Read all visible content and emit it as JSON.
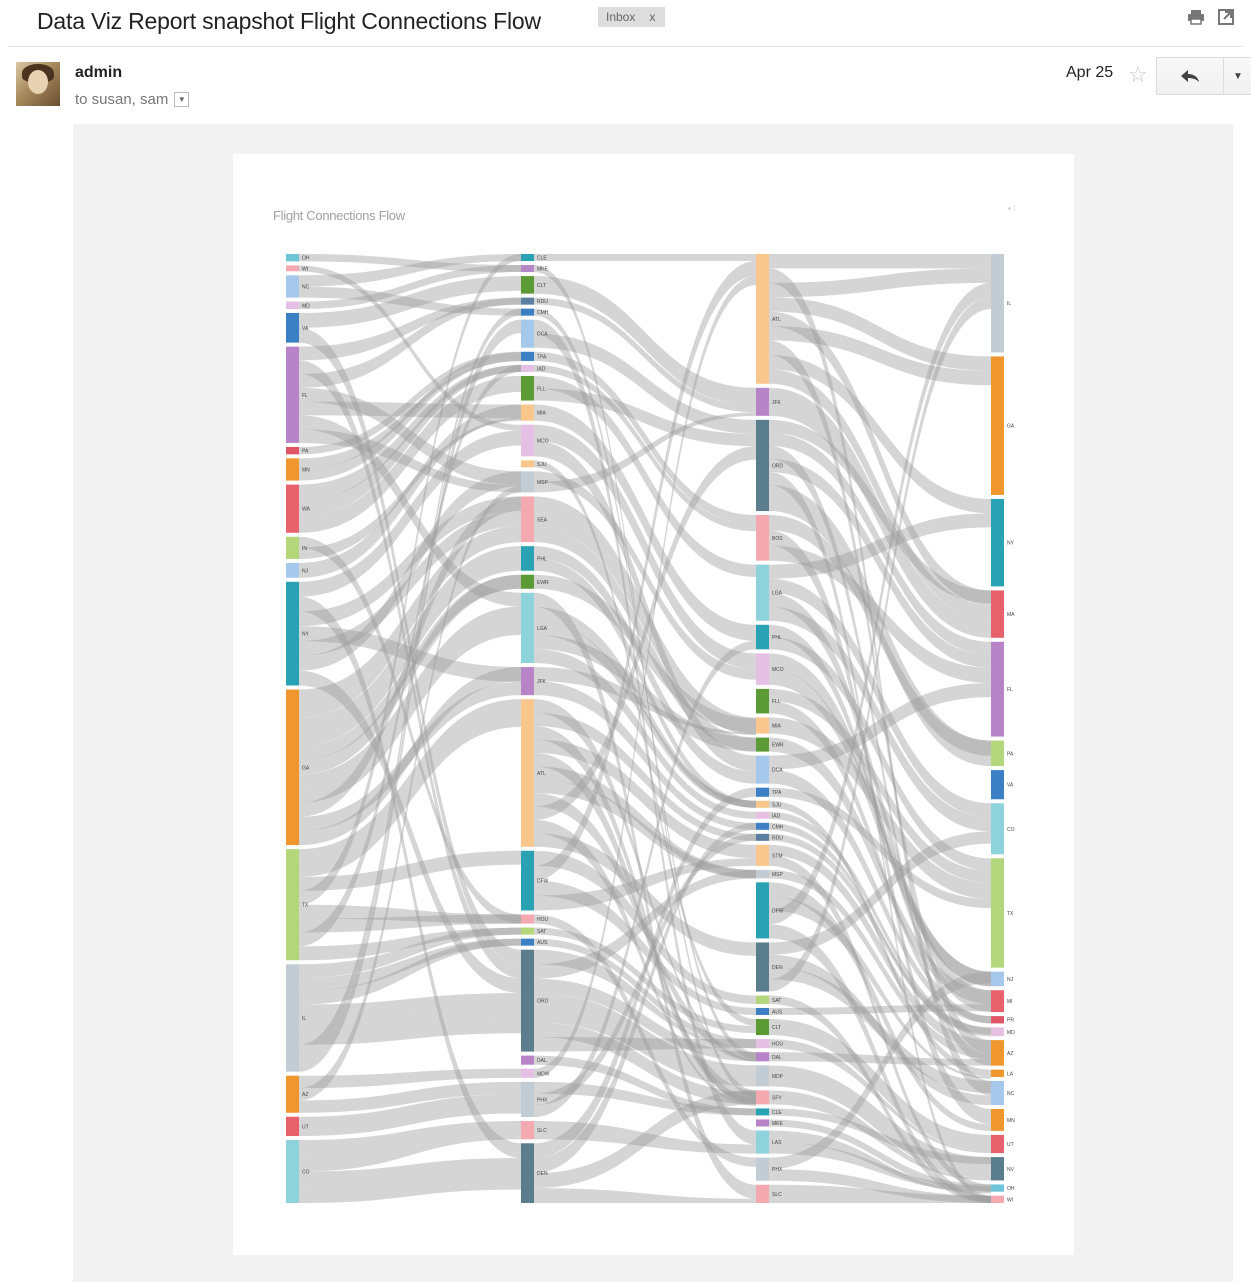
{
  "email": {
    "subject": "Data Viz Report snapshot Flight Connections Flow",
    "label": "Inbox",
    "label_remove": "x",
    "sender": "admin",
    "recipients": "to susan, sam",
    "date": "Apr 25",
    "icons": {
      "print": "print-icon",
      "new_window": "new-window-icon",
      "star": "star-icon",
      "reply": "reply-icon",
      "more": "chevron-down-icon"
    }
  },
  "chart_data": {
    "type": "sankey",
    "title": "Flight Connections Flow",
    "columns": [
      [
        {
          "id": "c1_0",
          "name": "OH",
          "color": "#6ec6d8",
          "w": 1
        },
        {
          "id": "c1_1",
          "name": "WI",
          "color": "#f4a9b0",
          "w": 0.8
        },
        {
          "id": "c1_2",
          "name": "NC",
          "color": "#a6c8ea",
          "w": 3
        },
        {
          "id": "c1_3",
          "name": "MD",
          "color": "#e6bfe4",
          "w": 1
        },
        {
          "id": "c1_4",
          "name": "VA",
          "color": "#3b7fc4",
          "w": 4
        },
        {
          "id": "c1_5",
          "name": "FL",
          "color": "#b784c7",
          "w": 13
        },
        {
          "id": "c1_6",
          "name": "PA",
          "color": "#e05566",
          "w": 1
        },
        {
          "id": "c1_7",
          "name": "MN",
          "color": "#f0962e",
          "w": 3
        },
        {
          "id": "c1_8",
          "name": "WA",
          "color": "#e8626e",
          "w": 6.5
        },
        {
          "id": "c1_9",
          "name": "IN",
          "color": "#b4d77c",
          "w": 3
        },
        {
          "id": "c1_10",
          "name": "NJ",
          "color": "#a6c8ea",
          "w": 2
        },
        {
          "id": "c1_11",
          "name": "NY",
          "color": "#29a3b4",
          "w": 14
        },
        {
          "id": "c1_12",
          "name": "GA",
          "color": "#f0962e",
          "w": 21
        },
        {
          "id": "c1_13",
          "name": "TX",
          "color": "#b4d77c",
          "w": 15
        },
        {
          "id": "c1_14",
          "name": "IL",
          "color": "#c1ccd4",
          "w": 14.5
        },
        {
          "id": "c1_15",
          "name": "AZ",
          "color": "#f0962e",
          "w": 5
        },
        {
          "id": "c1_16",
          "name": "UT",
          "color": "#e8626e",
          "w": 2.6
        },
        {
          "id": "c1_17",
          "name": "CO",
          "color": "#8ed2dc",
          "w": 8.5
        }
      ],
      [
        {
          "id": "c2_0",
          "name": "CLE",
          "color": "#29a3b4",
          "w": 1
        },
        {
          "id": "c2_1",
          "name": "MKE",
          "color": "#b784c7",
          "w": 1
        },
        {
          "id": "c2_2",
          "name": "CLT",
          "color": "#5c9a36",
          "w": 2.5
        },
        {
          "id": "c2_3",
          "name": "RDU",
          "color": "#5a7fa0",
          "w": 1
        },
        {
          "id": "c2_4",
          "name": "CMH",
          "color": "#3b7fc4",
          "w": 1
        },
        {
          "id": "c2_5",
          "name": "DCA",
          "color": "#a6c8ea",
          "w": 4
        },
        {
          "id": "c2_6",
          "name": "TPA",
          "color": "#3b7fc4",
          "w": 1.3
        },
        {
          "id": "c2_7",
          "name": "IAD",
          "color": "#e6bfe4",
          "w": 1
        },
        {
          "id": "c2_8",
          "name": "FLL",
          "color": "#5c9a36",
          "w": 3.5
        },
        {
          "id": "c2_9",
          "name": "MIA",
          "color": "#f9c68c",
          "w": 2.3
        },
        {
          "id": "c2_10",
          "name": "MCO",
          "color": "#e6bfe4",
          "w": 4.5
        },
        {
          "id": "c2_11",
          "name": "SJU",
          "color": "#f9c68c",
          "w": 1
        },
        {
          "id": "c2_12",
          "name": "MSP",
          "color": "#c1ccd4",
          "w": 3
        },
        {
          "id": "c2_13",
          "name": "SEA",
          "color": "#f4a9b0",
          "w": 6.5
        },
        {
          "id": "c2_14",
          "name": "PHL",
          "color": "#29a3b4",
          "w": 3.5
        },
        {
          "id": "c2_15",
          "name": "EWR",
          "color": "#5c9a36",
          "w": 2
        },
        {
          "id": "c2_16",
          "name": "LGA",
          "color": "#8ed2dc",
          "w": 10
        },
        {
          "id": "c2_17",
          "name": "JFK",
          "color": "#b784c7",
          "w": 4
        },
        {
          "id": "c2_18",
          "name": "ATL",
          "color": "#f9c68c",
          "w": 21
        },
        {
          "id": "c2_19",
          "name": "DFW",
          "color": "#29a3b4",
          "w": 8.5
        },
        {
          "id": "c2_20",
          "name": "HOU",
          "color": "#f4a9b0",
          "w": 1.3
        },
        {
          "id": "c2_21",
          "name": "SAT",
          "color": "#b4d77c",
          "w": 1
        },
        {
          "id": "c2_22",
          "name": "AUS",
          "color": "#3b7fc4",
          "w": 1
        },
        {
          "id": "c2_23",
          "name": "ORD",
          "color": "#5a7e8e",
          "w": 14.5
        },
        {
          "id": "c2_24",
          "name": "DAL",
          "color": "#b784c7",
          "w": 1.3
        },
        {
          "id": "c2_25",
          "name": "MDW",
          "color": "#e6bfe4",
          "w": 1.3
        },
        {
          "id": "c2_26",
          "name": "PHX",
          "color": "#c1ccd4",
          "w": 5
        },
        {
          "id": "c2_27",
          "name": "SLC",
          "color": "#f4a9b0",
          "w": 2.6
        },
        {
          "id": "c2_28",
          "name": "DEN",
          "color": "#5a7e8e",
          "w": 8.5
        }
      ],
      [
        {
          "id": "c3_0",
          "name": "ATL",
          "color": "#f9c68c",
          "w": 18.5
        },
        {
          "id": "c3_1",
          "name": "JFK",
          "color": "#b784c7",
          "w": 4
        },
        {
          "id": "c3_2",
          "name": "ORD",
          "color": "#5a7e8e",
          "w": 13
        },
        {
          "id": "c3_3",
          "name": "BOS",
          "color": "#f4a9b0",
          "w": 6.5
        },
        {
          "id": "c3_4",
          "name": "LGA",
          "color": "#8ed2dc",
          "w": 8
        },
        {
          "id": "c3_5",
          "name": "PHL",
          "color": "#29a3b4",
          "w": 3.5
        },
        {
          "id": "c3_6",
          "name": "MCO",
          "color": "#e6bfe4",
          "w": 4.5
        },
        {
          "id": "c3_7",
          "name": "FLL",
          "color": "#5c9a36",
          "w": 3.5
        },
        {
          "id": "c3_8",
          "name": "MIA",
          "color": "#f9c68c",
          "w": 2.3
        },
        {
          "id": "c3_9",
          "name": "EWR",
          "color": "#5c9a36",
          "w": 2
        },
        {
          "id": "c3_10",
          "name": "DCA",
          "color": "#a6c8ea",
          "w": 4
        },
        {
          "id": "c3_11",
          "name": "TPA",
          "color": "#3b7fc4",
          "w": 1.3
        },
        {
          "id": "c3_12",
          "name": "SJU",
          "color": "#f9c68c",
          "w": 1
        },
        {
          "id": "c3_13",
          "name": "IAD",
          "color": "#e6bfe4",
          "w": 1
        },
        {
          "id": "c3_14",
          "name": "CMH",
          "color": "#3b7fc4",
          "w": 1
        },
        {
          "id": "c3_15",
          "name": "RDU",
          "color": "#5a7fa0",
          "w": 1
        },
        {
          "id": "c3_16",
          "name": "STM",
          "color": "#f9c68c",
          "w": 3
        },
        {
          "id": "c3_17",
          "name": "MSP",
          "color": "#c1ccd4",
          "w": 1.2
        },
        {
          "id": "c3_18",
          "name": "DFW",
          "color": "#29a3b4",
          "w": 8
        },
        {
          "id": "c3_19",
          "name": "DEN",
          "color": "#5a7e8e",
          "w": 7
        },
        {
          "id": "c3_20",
          "name": "SAT",
          "color": "#b4d77c",
          "w": 1.2
        },
        {
          "id": "c3_21",
          "name": "AUS",
          "color": "#3b7fc4",
          "w": 1
        },
        {
          "id": "c3_22",
          "name": "CLT",
          "color": "#5c9a36",
          "w": 2.3
        },
        {
          "id": "c3_23",
          "name": "HOU",
          "color": "#e6bfe4",
          "w": 1.3
        },
        {
          "id": "c3_24",
          "name": "DAL",
          "color": "#b784c7",
          "w": 1.3
        },
        {
          "id": "c3_25",
          "name": "MDP",
          "color": "#c1ccd4",
          "w": 3
        },
        {
          "id": "c3_26",
          "name": "SFY",
          "color": "#f4a9b0",
          "w": 2
        },
        {
          "id": "c3_27",
          "name": "CLE",
          "color": "#29a3b4",
          "w": 1
        },
        {
          "id": "c3_28",
          "name": "MKE",
          "color": "#b784c7",
          "w": 1
        },
        {
          "id": "c3_29",
          "name": "LAS",
          "color": "#8ed2dc",
          "w": 3.3
        },
        {
          "id": "c3_30",
          "name": "PHX",
          "color": "#c1ccd4",
          "w": 3.3
        },
        {
          "id": "c3_31",
          "name": "SLC",
          "color": "#f4a9b0",
          "w": 2.6
        }
      ],
      [
        {
          "id": "c4_0",
          "name": "IL",
          "color": "#c1ccd4",
          "w": 13.5
        },
        {
          "id": "c4_1",
          "name": "GA",
          "color": "#f0962e",
          "w": 19
        },
        {
          "id": "c4_2",
          "name": "NY",
          "color": "#29a3b4",
          "w": 12
        },
        {
          "id": "c4_3",
          "name": "MA",
          "color": "#e8626e",
          "w": 6.5
        },
        {
          "id": "c4_4",
          "name": "FL",
          "color": "#b784c7",
          "w": 13
        },
        {
          "id": "c4_5",
          "name": "PA",
          "color": "#b4d77c",
          "w": 3.5
        },
        {
          "id": "c4_6",
          "name": "VA",
          "color": "#3b7fc4",
          "w": 4
        },
        {
          "id": "c4_7",
          "name": "CO",
          "color": "#8ed2dc",
          "w": 7
        },
        {
          "id": "c4_8",
          "name": "TX",
          "color": "#b4d77c",
          "w": 15
        },
        {
          "id": "c4_9",
          "name": "NJ",
          "color": "#a6c8ea",
          "w": 2
        },
        {
          "id": "c4_10",
          "name": "MI",
          "color": "#e8626e",
          "w": 3
        },
        {
          "id": "c4_11",
          "name": "PR",
          "color": "#e05566",
          "w": 1
        },
        {
          "id": "c4_12",
          "name": "MD",
          "color": "#e6bfe4",
          "w": 1.2
        },
        {
          "id": "c4_13",
          "name": "AZ",
          "color": "#f0962e",
          "w": 3.5
        },
        {
          "id": "c4_14",
          "name": "LA",
          "color": "#f0962e",
          "w": 1
        },
        {
          "id": "c4_15",
          "name": "NC",
          "color": "#a6c8ea",
          "w": 3.3
        },
        {
          "id": "c4_16",
          "name": "MN",
          "color": "#f0962e",
          "w": 3
        },
        {
          "id": "c4_17",
          "name": "UT",
          "color": "#e8626e",
          "w": 2.5
        },
        {
          "id": "c4_18",
          "name": "NV",
          "color": "#5a7e8e",
          "w": 3.2
        },
        {
          "id": "c4_19",
          "name": "OH",
          "color": "#6ec6d8",
          "w": 1
        },
        {
          "id": "c4_20",
          "name": "WI",
          "color": "#f4a9b0",
          "w": 1
        }
      ]
    ]
  }
}
